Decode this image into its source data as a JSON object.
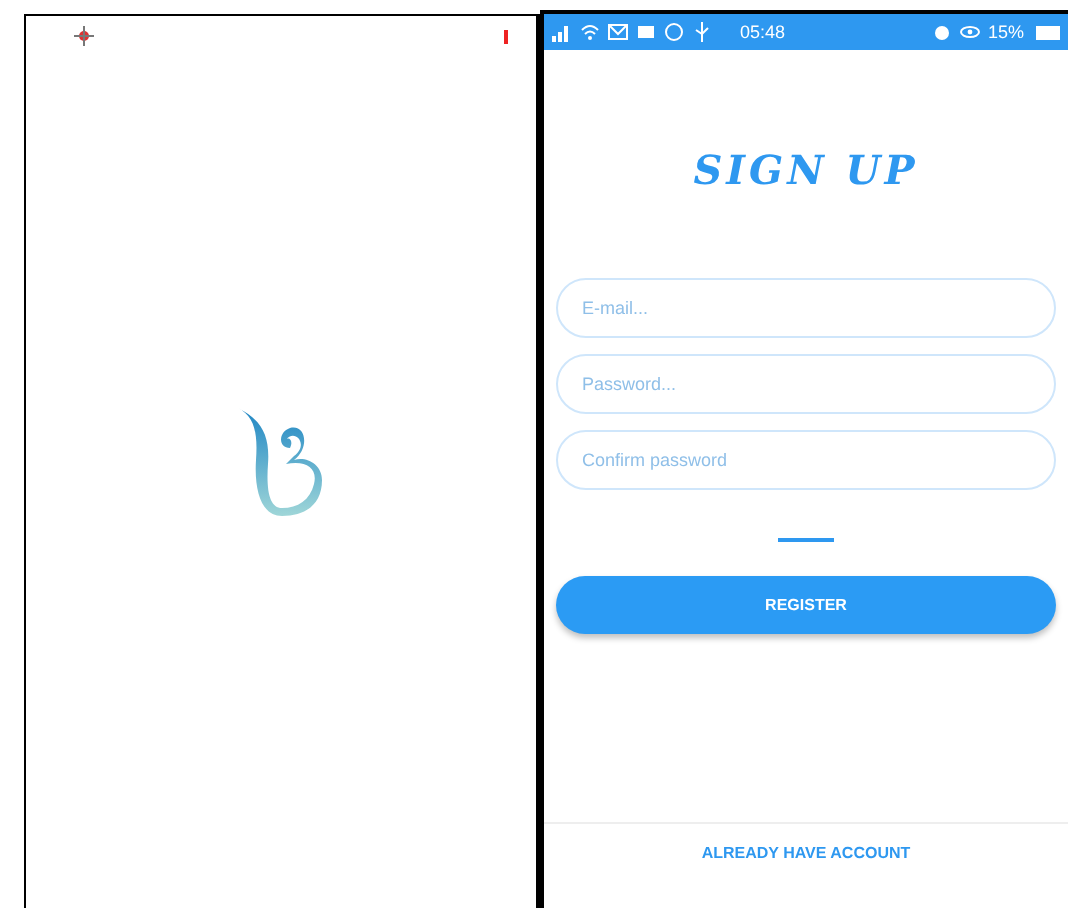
{
  "status_bar": {
    "time": "05:48",
    "battery": "15%"
  },
  "title": "SIGN UP",
  "fields": [
    {
      "placeholder": "E-mail..."
    },
    {
      "placeholder": "Password..."
    },
    {
      "placeholder": "Confirm password"
    }
  ],
  "register_button": "REGISTER",
  "login_link": "ALREADY HAVE ACCOUNT"
}
